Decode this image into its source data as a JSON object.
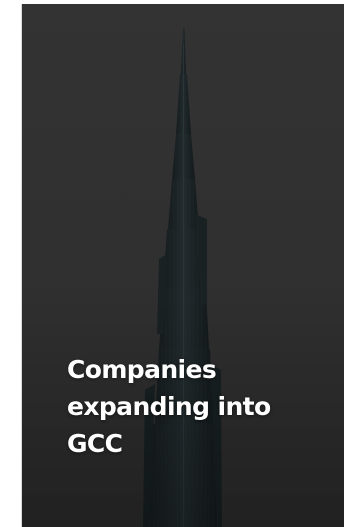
{
  "card": {
    "headline": "Companies expanding into GCC",
    "image_subject": "skyscraper-tower",
    "colors": {
      "background": "#303030",
      "tower": "#1d2426",
      "text": "#ffffff"
    }
  }
}
